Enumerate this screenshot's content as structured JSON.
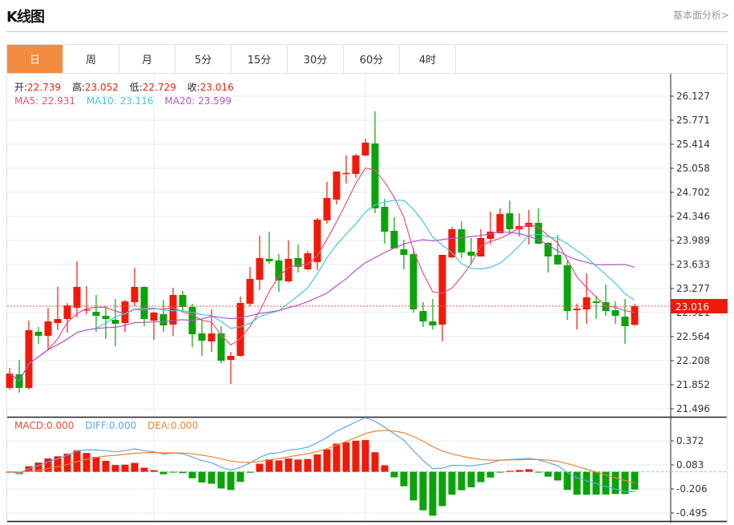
{
  "header": {
    "title": "K线图",
    "link": "基本面分析>"
  },
  "tabs": [
    {
      "label": "日",
      "active": true
    },
    {
      "label": "周"
    },
    {
      "label": "月"
    },
    {
      "label": "5分"
    },
    {
      "label": "15分"
    },
    {
      "label": "30分"
    },
    {
      "label": "60分"
    },
    {
      "label": "4时"
    }
  ],
  "legend": {
    "open_label": "开:",
    "open": "22.739",
    "high_label": "高:",
    "high": "23.052",
    "low_label": "低:",
    "low": "22.729",
    "close_label": "收:",
    "close": "23.016",
    "ma5": "MA5: 22.931",
    "ma10": "MA10: 23.116",
    "ma20": "MA20: 23.599",
    "macd": "MACD:0.000",
    "diff": "DIFF:0.000",
    "dea": "DEA:0.000"
  },
  "colors": {
    "up": "#f01a0a",
    "down": "#0aa30a",
    "ma5": "#ee4f86",
    "ma10": "#44c8dc",
    "ma20": "#b553c8",
    "diff": "#5aa9f0",
    "dea": "#f5822a",
    "macd": "#f04a3a",
    "active_tab": "#f28c3f"
  },
  "chart_data": {
    "type": "candlestick",
    "current_price": "23.016",
    "y_ticks": [
      "26.127",
      "25.771",
      "25.414",
      "25.058",
      "24.702",
      "24.346",
      "23.989",
      "23.633",
      "23.277",
      "22.921",
      "22.564",
      "22.208",
      "21.852",
      "21.496"
    ],
    "ylim": [
      21.496,
      26.127
    ],
    "grid": true,
    "candles_ohlc": [
      [
        21.805,
        22.102,
        21.781,
        22.018
      ],
      [
        22.007,
        22.22,
        21.734,
        21.805
      ],
      [
        21.805,
        22.802,
        21.781,
        22.66
      ],
      [
        22.636,
        22.707,
        22.458,
        22.577
      ],
      [
        22.577,
        22.992,
        22.363,
        22.79
      ],
      [
        22.766,
        23.301,
        22.66,
        22.826
      ],
      [
        22.826,
        23.063,
        22.624,
        23.028
      ],
      [
        22.992,
        23.681,
        22.85,
        23.301
      ],
      [
        22.956,
        23.312,
        22.897,
        22.968
      ],
      [
        22.933,
        23.182,
        22.636,
        22.873
      ],
      [
        22.873,
        23.016,
        22.529,
        22.826
      ],
      [
        22.814,
        23.123,
        22.422,
        22.755
      ],
      [
        22.766,
        23.111,
        22.636,
        23.087
      ],
      [
        23.075,
        23.586,
        23.016,
        23.301
      ],
      [
        23.301,
        23.313,
        22.719,
        22.826
      ],
      [
        22.802,
        22.933,
        22.517,
        22.921
      ],
      [
        22.897,
        23.111,
        22.636,
        22.731
      ],
      [
        22.743,
        23.289,
        22.577,
        23.182
      ],
      [
        23.182,
        23.242,
        22.956,
        23.004
      ],
      [
        23.004,
        23.052,
        22.41,
        22.6
      ],
      [
        22.612,
        22.826,
        22.28,
        22.505
      ],
      [
        22.493,
        22.968,
        22.339,
        22.612
      ],
      [
        22.612,
        22.719,
        22.173,
        22.208
      ],
      [
        22.22,
        22.339,
        21.864,
        22.28
      ],
      [
        22.28,
        23.159,
        22.268,
        23.063
      ],
      [
        23.052,
        23.598,
        23.016,
        23.42
      ],
      [
        23.408,
        24.061,
        23.254,
        23.729
      ],
      [
        23.717,
        24.12,
        23.646,
        23.681
      ],
      [
        23.693,
        23.788,
        23.23,
        23.396
      ],
      [
        23.384,
        23.99,
        23.372,
        23.717
      ],
      [
        23.729,
        23.93,
        23.515,
        23.598
      ],
      [
        23.562,
        23.835,
        23.55,
        23.8
      ],
      [
        23.669,
        24.322,
        23.55,
        24.298
      ],
      [
        24.287,
        24.857,
        24.239,
        24.619
      ],
      [
        24.596,
        25.011,
        24.524,
        25.011
      ],
      [
        24.987,
        25.249,
        24.833,
        24.99
      ],
      [
        24.975,
        25.272,
        24.916,
        25.249
      ],
      [
        25.249,
        25.498,
        25.237,
        25.439
      ],
      [
        25.427,
        25.902,
        24.393,
        24.465
      ],
      [
        24.488,
        24.607,
        23.942,
        24.12
      ],
      [
        24.132,
        24.334,
        23.871,
        23.871
      ],
      [
        23.859,
        24.002,
        23.562,
        23.776
      ],
      [
        23.788,
        23.871,
        22.921,
        22.968
      ],
      [
        22.944,
        23.075,
        22.707,
        22.79
      ],
      [
        22.79,
        23.123,
        22.672,
        22.731
      ],
      [
        22.743,
        23.776,
        22.493,
        23.776
      ],
      [
        23.74,
        24.191,
        23.729,
        24.156
      ],
      [
        24.156,
        24.275,
        23.729,
        23.811
      ],
      [
        23.823,
        24.025,
        23.634,
        23.764
      ],
      [
        23.752,
        24.156,
        23.752,
        24.025
      ],
      [
        24.013,
        24.417,
        23.93,
        24.12
      ],
      [
        24.096,
        24.465,
        24.096,
        24.381
      ],
      [
        24.393,
        24.583,
        24.085,
        24.156
      ],
      [
        24.156,
        24.393,
        24.049,
        24.203
      ],
      [
        24.191,
        24.441,
        23.93,
        24.251
      ],
      [
        24.251,
        24.465,
        23.93,
        23.942
      ],
      [
        23.954,
        23.966,
        23.515,
        23.752
      ],
      [
        23.776,
        24.073,
        23.634,
        23.634
      ],
      [
        23.622,
        23.693,
        22.814,
        22.944
      ],
      [
        22.956,
        23.052,
        22.672,
        22.98
      ],
      [
        22.968,
        23.503,
        22.755,
        23.147
      ],
      [
        23.087,
        23.17,
        22.826,
        23.064
      ],
      [
        23.075,
        23.336,
        22.873,
        22.944
      ],
      [
        22.956,
        23.087,
        22.755,
        22.873
      ],
      [
        22.861,
        23.123,
        22.458,
        22.719
      ],
      [
        22.739,
        23.052,
        22.729,
        23.016
      ]
    ],
    "moving_averages": [
      "MA5",
      "MA10",
      "MA20"
    ],
    "macd_panel": {
      "y_ticks": [
        "0.372",
        "0.083",
        "-0.206",
        "-0.495"
      ],
      "ylim": [
        -0.495,
        0.372
      ],
      "series": [
        "MACD",
        "DIFF",
        "DEA"
      ]
    }
  }
}
